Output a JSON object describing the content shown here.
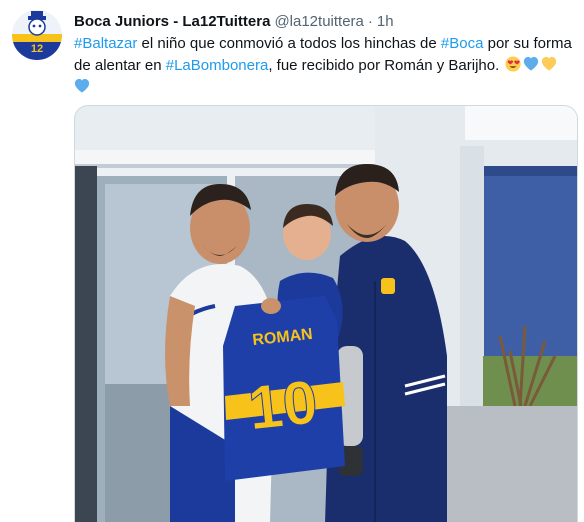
{
  "tweet": {
    "author_name": "Boca Juniors - La12Tuittera",
    "author_handle": "@la12tuittera",
    "separator": "·",
    "time": "1h",
    "text": {
      "tag1": "#Baltazar",
      "part1": " el niño que conmovió a todos los hinchas de ",
      "tag2": "#Boca",
      "part2": " por su forma de alentar en ",
      "tag3": "#LaBombonera",
      "part3": ", fue recibido por Román y Barijho."
    },
    "emojis": [
      "heart-eyes-icon",
      "blue-heart-icon",
      "yellow-heart-icon",
      "blue-heart-icon"
    ],
    "avatar_number": "12",
    "photo": {
      "jersey_name": "ROMAN",
      "jersey_number": "10"
    }
  },
  "colors": {
    "link": "#1d9bf0",
    "boca_blue": "#1b3a9c",
    "boca_yellow": "#f7c31a",
    "muted": "#536471"
  }
}
